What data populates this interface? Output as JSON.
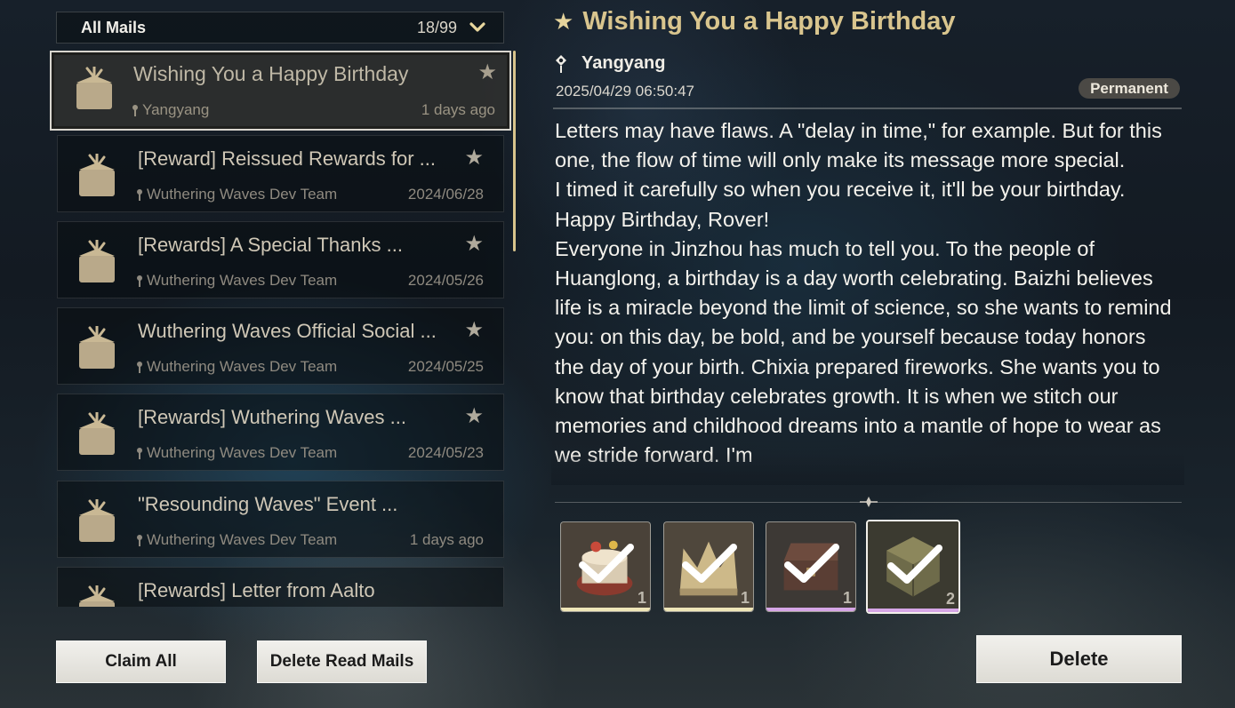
{
  "filter": {
    "title": "All Mails",
    "count": "18/99"
  },
  "mails": [
    {
      "title": "Wishing You a Happy Birthday",
      "sender": "Yangyang",
      "date": "1 days ago",
      "starred": true,
      "selected": true
    },
    {
      "title": "[Reward] Reissued Rewards for ...",
      "sender": "Wuthering Waves Dev Team",
      "date": "2024/06/28",
      "starred": true
    },
    {
      "title": "[Rewards] A Special Thanks ...",
      "sender": "Wuthering Waves Dev Team",
      "date": "2024/05/26",
      "starred": true
    },
    {
      "title": "Wuthering Waves Official Social ...",
      "sender": "Wuthering Waves Dev Team",
      "date": "2024/05/25",
      "starred": true
    },
    {
      "title": "[Rewards] Wuthering Waves ...",
      "sender": "Wuthering Waves Dev Team",
      "date": "2024/05/23",
      "starred": true
    },
    {
      "title": "\"Resounding Waves\" Event ...",
      "sender": "Wuthering Waves Dev Team",
      "date": "1 days ago",
      "starred": false
    },
    {
      "title": "[Rewards] Letter from Aalto",
      "sender": "",
      "date": "",
      "starred": false
    }
  ],
  "buttons": {
    "claim_all": "Claim All",
    "delete_read": "Delete Read Mails",
    "delete": "Delete"
  },
  "detail": {
    "title": "Wishing You a Happy Birthday",
    "sender": "Yangyang",
    "datetime": "2025/04/29 06:50:47",
    "badge": "Permanent",
    "body": "Letters may have flaws. A \"delay in time,\" for example. But for this one, the flow of time will only make its message more special.\nI timed it carefully so when you receive it, it'll be your birthday.\nHappy Birthday, Rover!\nEveryone in Jinzhou has much to tell you. To the people of Huanglong, a birthday is a day worth celebrating. Baizhi believes life is a miracle beyond the limit of science, so she wants to remind you: on this day, be bold, and be yourself because today honors the day of your birth. Chixia prepared fireworks. She wants you to know that birthday celebrates growth. It is when we stitch our memories and childhood dreams into a mantle of hope to wear as we stride forward. I'm"
  },
  "rewards": [
    {
      "qty": "1",
      "claimed": true,
      "rarity_color": "#efe6b8",
      "icon": "cake-item-icon"
    },
    {
      "qty": "1",
      "claimed": true,
      "rarity_color": "#efe6b8",
      "icon": "crown-item-icon"
    },
    {
      "qty": "1",
      "claimed": true,
      "rarity_color": "#d6a6e6",
      "icon": "chest-item-icon"
    },
    {
      "qty": "2",
      "claimed": true,
      "rarity_color": "#d6a6e6",
      "icon": "cube-item-icon",
      "selected": true
    }
  ],
  "colors": {
    "accent_gold": "#d9c58e",
    "scrollbar": "#d8c48c",
    "badge_bg": "#4b4945"
  }
}
